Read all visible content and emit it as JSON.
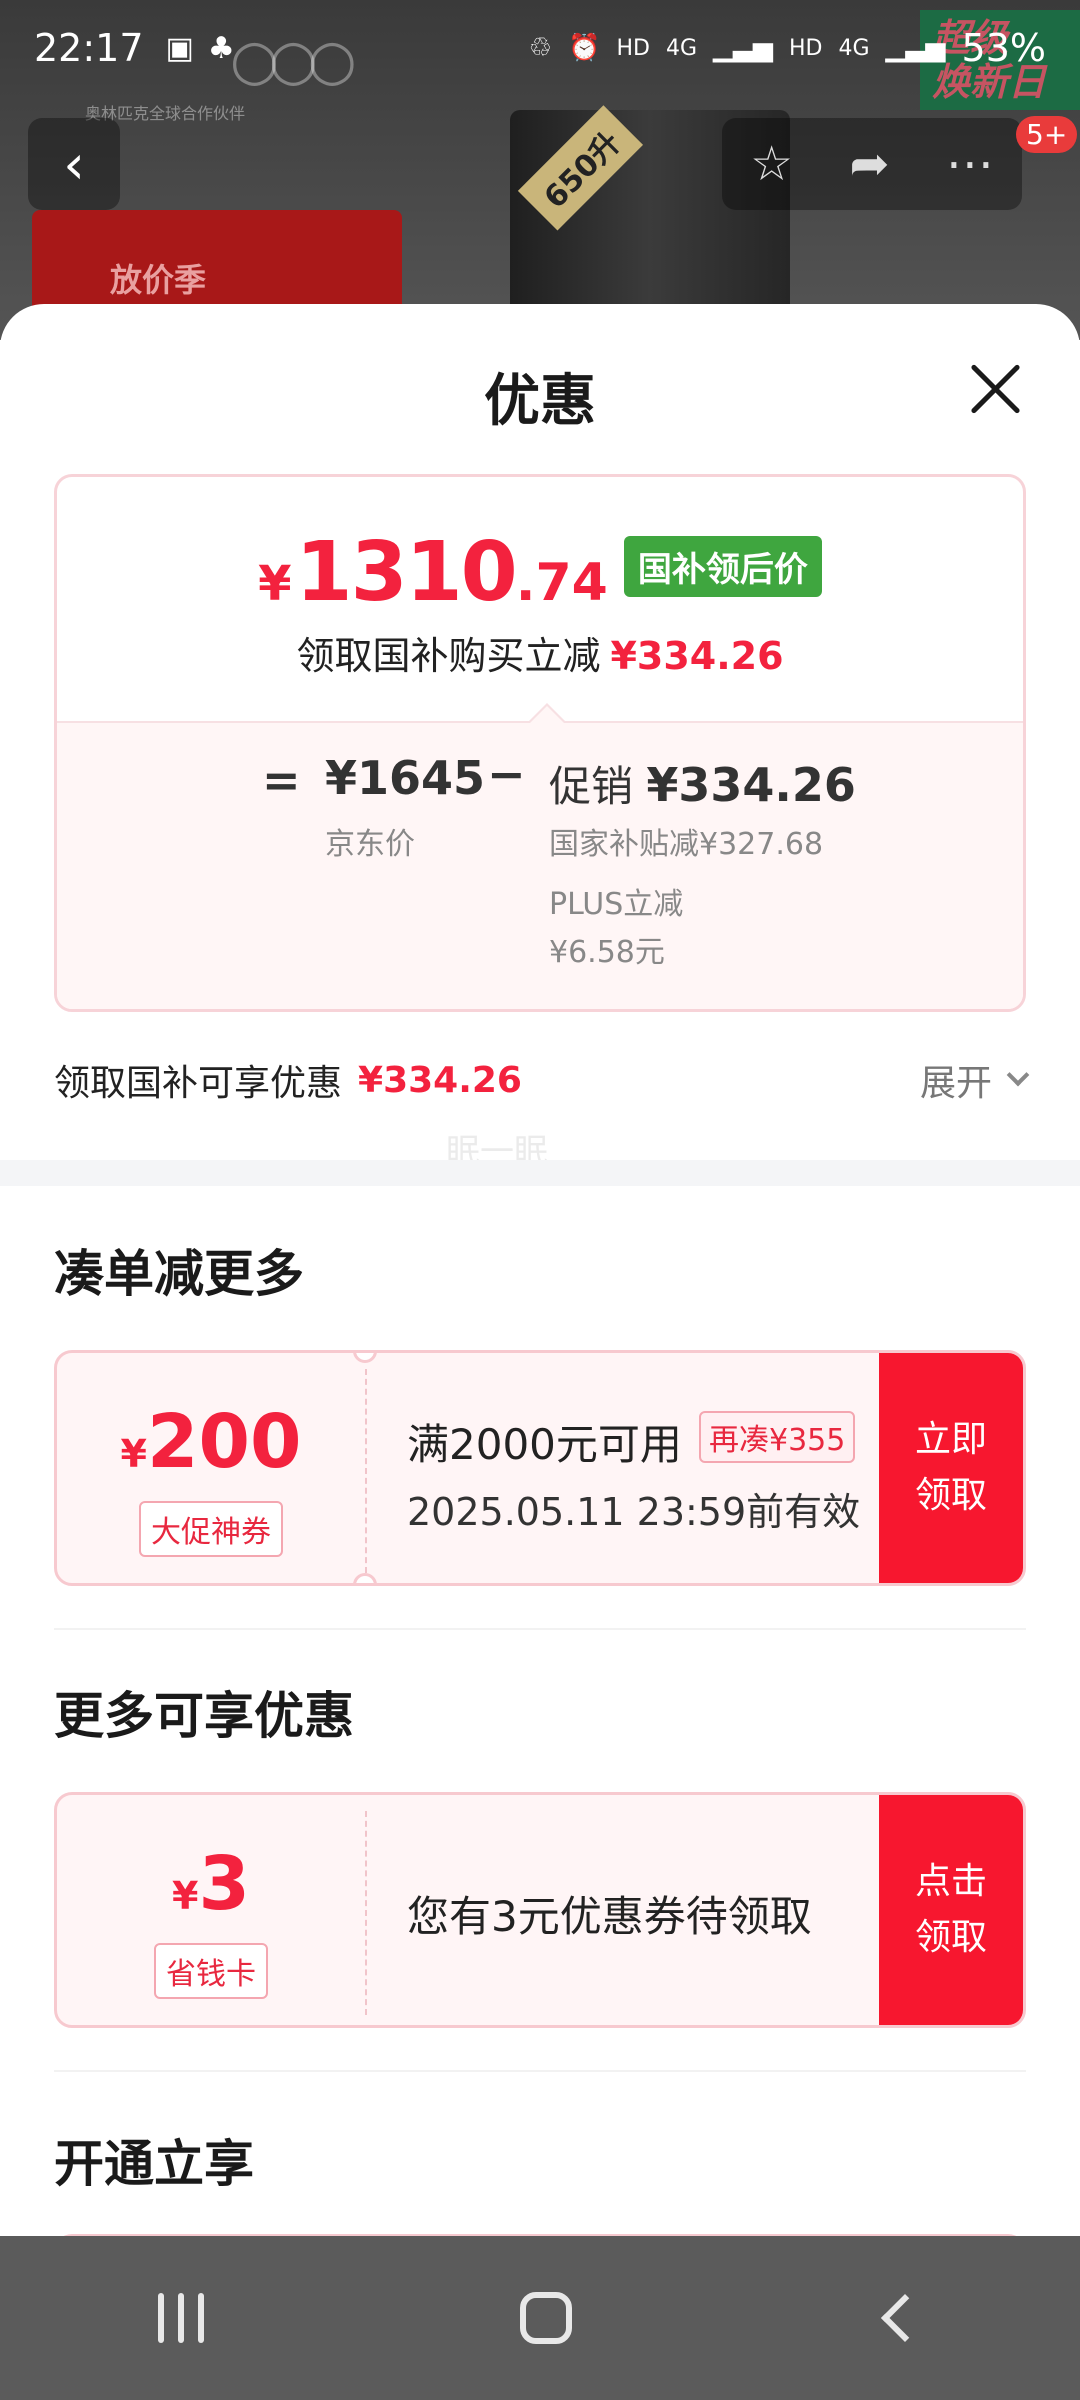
{
  "status_bar": {
    "time": "22:17",
    "network_labels": [
      "HD",
      "4G",
      "HD",
      "4G"
    ],
    "battery": "53%"
  },
  "background": {
    "fridge_tag": "650升",
    "promo_text": "放价季",
    "logo_sub": "奥林匹克全球合作伙伴",
    "promo_badge_line1": "超级",
    "promo_badge_line2": "焕新日",
    "nav_badge": "5+"
  },
  "sheet": {
    "title": "优惠",
    "price": {
      "currency": "¥",
      "integer": "1310",
      "decimal": ".74",
      "tag": "国补领后价",
      "sub_text": "领取国补购买立减",
      "sub_value": "¥334.26"
    },
    "breakdown": {
      "equals": "=",
      "jd_price": "¥1645",
      "jd_label": "京东价",
      "minus": "−",
      "promo_label": "促销",
      "promo_value": "¥334.26",
      "subsidy": "国家补贴减¥327.68",
      "plus_label": "PLUS立减",
      "plus_value": "¥6.58元"
    },
    "summary": {
      "label": "领取国补可享优惠",
      "value": "¥334.26",
      "expand": "展开"
    },
    "watermark": "眠一眠",
    "sections": {
      "combine": {
        "title": "凑单减更多",
        "coupon": {
          "currency": "¥",
          "amount": "200",
          "label": "大促神券",
          "condition": "满2000元可用",
          "extra": "再凑¥355",
          "date": "2025.05.11 23:59前有效",
          "btn_line1": "立即",
          "btn_line2": "领取"
        }
      },
      "more": {
        "title": "更多可享优惠",
        "coupon": {
          "currency": "¥",
          "amount": "3",
          "label": "省钱卡",
          "text": "您有3元优惠券待领取",
          "btn_line1": "点击",
          "btn_line2": "领取"
        }
      },
      "open": {
        "title": "开通立享"
      }
    }
  }
}
